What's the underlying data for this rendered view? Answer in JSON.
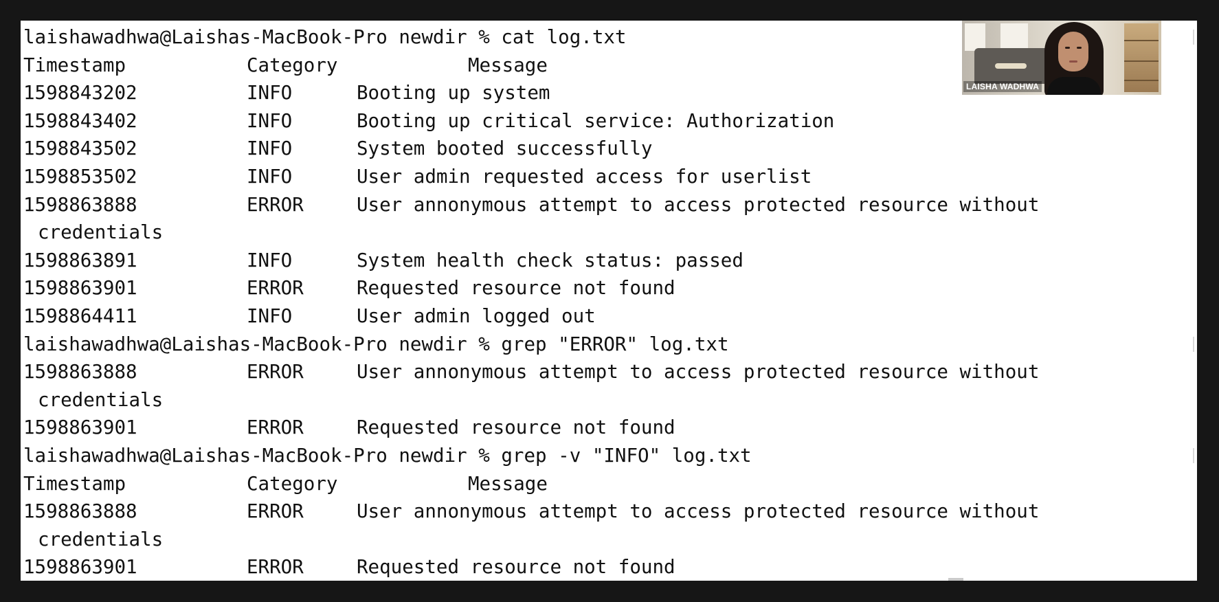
{
  "theme": {
    "background": "#161616",
    "terminal_bg": "#ffffff",
    "text_color": "#111111"
  },
  "webcam": {
    "participant_name": "LAISHA WADHWA"
  },
  "terminal": {
    "lines": [
      {
        "kind": "command",
        "text": "laishawadhwa@Laishas-MacBook-Pro newdir % cat log.txt"
      },
      {
        "kind": "header",
        "ts": "Timestamp",
        "cat": "Category",
        "msg": "Message"
      },
      {
        "kind": "row",
        "ts": "1598843202",
        "cat": "INFO",
        "msg": "Booting up system"
      },
      {
        "kind": "row",
        "ts": "1598843402",
        "cat": "INFO",
        "msg": "Booting up critical service: Authorization"
      },
      {
        "kind": "row",
        "ts": "1598843502",
        "cat": "INFO",
        "msg": "System booted successfully"
      },
      {
        "kind": "row",
        "ts": "1598853502",
        "cat": "INFO",
        "msg": "User admin requested access for userlist"
      },
      {
        "kind": "row",
        "ts": "1598863888",
        "cat": "ERROR",
        "msg": "User annonymous attempt to access protected resource without"
      },
      {
        "kind": "wrap",
        "text": "credentials"
      },
      {
        "kind": "row",
        "ts": "1598863891",
        "cat": "INFO",
        "msg": "System health check status: passed"
      },
      {
        "kind": "row",
        "ts": "1598863901",
        "cat": "ERROR",
        "msg": "Requested resource not found"
      },
      {
        "kind": "row",
        "ts": "1598864411",
        "cat": "INFO",
        "msg": "User admin logged out"
      },
      {
        "kind": "command",
        "text": "laishawadhwa@Laishas-MacBook-Pro newdir % grep \"ERROR\" log.txt"
      },
      {
        "kind": "row",
        "ts": "1598863888",
        "cat": "ERROR",
        "msg": "User annonymous attempt to access protected resource without"
      },
      {
        "kind": "wrap",
        "text": "credentials"
      },
      {
        "kind": "row",
        "ts": "1598863901",
        "cat": "ERROR",
        "msg": "Requested resource not found"
      },
      {
        "kind": "command",
        "text": "laishawadhwa@Laishas-MacBook-Pro newdir % grep -v \"INFO\" log.txt"
      },
      {
        "kind": "header",
        "ts": "Timestamp",
        "cat": "Category",
        "msg": "Message"
      },
      {
        "kind": "row",
        "ts": "1598863888",
        "cat": "ERROR",
        "msg": "User annonymous attempt to access protected resource without"
      },
      {
        "kind": "wrap",
        "text": "credentials"
      },
      {
        "kind": "row",
        "ts": "1598863901",
        "cat": "ERROR",
        "msg": "Requested resource not found"
      }
    ]
  }
}
